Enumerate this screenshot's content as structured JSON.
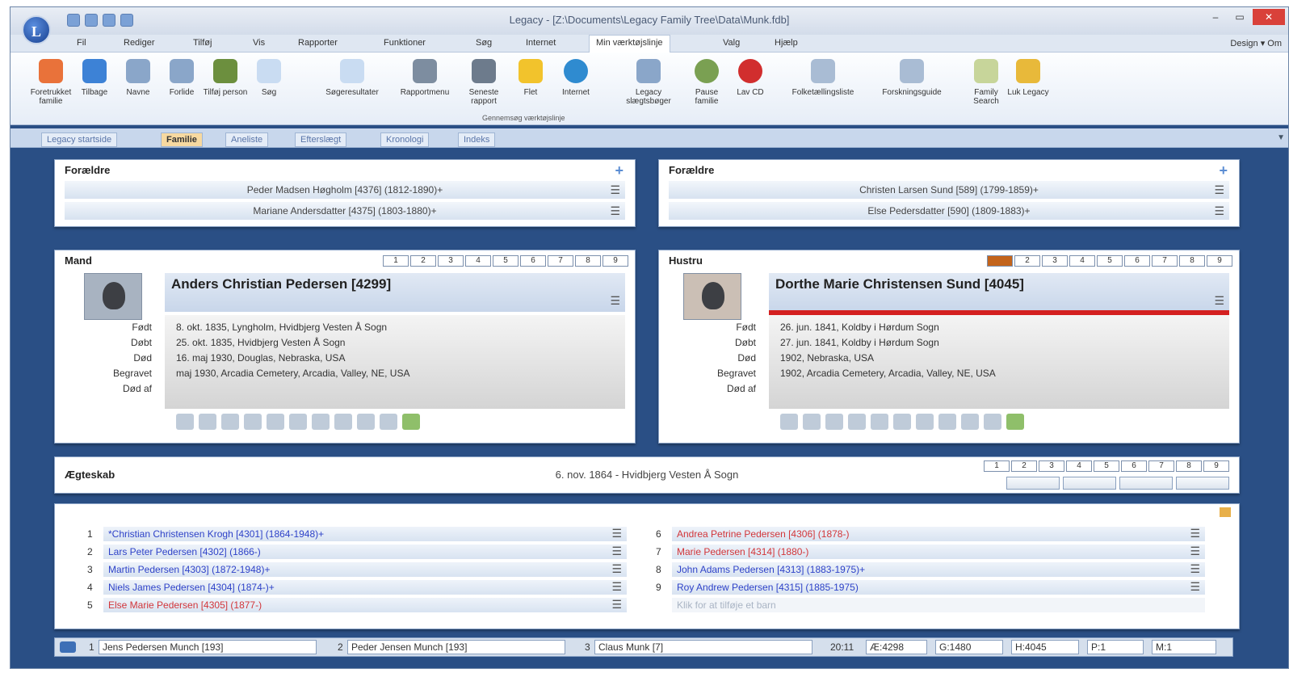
{
  "window": {
    "title": "Legacy - [Z:\\Documents\\Legacy Family Tree\\Data\\Munk.fdb]",
    "app_badge": "L",
    "controls": [
      "–",
      "▭",
      "✕"
    ]
  },
  "menubar": {
    "items": [
      "Fil",
      "Rediger",
      "Tilføj",
      "Vis",
      "Rapporter",
      "Funktioner",
      "Søg",
      "Internet",
      "Min værktøjslinje",
      "Valg",
      "Hjælp"
    ],
    "right": "Design  ▾ Om"
  },
  "ribbon": {
    "buttons": [
      "Foretrukket familie",
      "Tilbage",
      "Navne",
      "Forlide",
      "Tilføj person",
      "Søg",
      "Søgeresultater",
      "Rapportmenu",
      "Seneste rapport",
      "Flet",
      "Internet",
      "Legacy slægtsbøger",
      "Pause familie",
      "Lav CD",
      "Folketællingsliste",
      "Forskningsguide",
      "Family Search",
      "Luk Legacy"
    ],
    "group_label": "Gennemsøg værktøjslinje"
  },
  "view_tabs": [
    "Legacy startside",
    "Familie",
    "Aneliste",
    "Efterslægt",
    "Kronologi",
    "Indeks"
  ],
  "active_tab": "Familie",
  "left_parents": {
    "title": "Forældre",
    "father": "Peder Madsen Høgholm [4376] (1812-1890)+",
    "mother": "Mariane Andersdatter [4375] (1803-1880)+"
  },
  "right_parents": {
    "title": "Forældre",
    "father": "Christen Larsen Sund [589] (1799-1859)+",
    "mother": "Else Pedersdatter [590] (1809-1883)+"
  },
  "husband": {
    "title": "Mand",
    "name": "Anders Christian Pedersen [4299]",
    "spouse_numbers": [
      "1",
      "2",
      "3",
      "4",
      "5",
      "6",
      "7",
      "8",
      "9"
    ],
    "labels": [
      "Født",
      "Døbt",
      "Død",
      "Begravet",
      "Død af"
    ],
    "values": [
      "8. okt. 1835, Lyngholm, Hvidbjerg Vesten Å Sogn",
      "25. okt. 1835, Hvidbjerg Vesten Å Sogn",
      "16. maj 1930, Douglas, Nebraska, USA",
      "maj 1930, Arcadia Cemetery, Arcadia, Valley, NE, USA",
      ""
    ]
  },
  "wife": {
    "title": "Hustru",
    "name": "Dorthe Marie Christensen Sund [4045]",
    "spouse_numbers": [
      "1",
      "2",
      "3",
      "4",
      "5",
      "6",
      "7",
      "8",
      "9"
    ],
    "labels": [
      "Født",
      "Døbt",
      "Død",
      "Begravet",
      "Død af"
    ],
    "values": [
      "26. jun. 1841, Koldby i Hørdum Sogn",
      "27. jun. 1841, Koldby i Hørdum Sogn",
      "1902, Nebraska, USA",
      "1902, Arcadia Cemetery, Arcadia, Valley, NE, USA",
      ""
    ]
  },
  "marriage": {
    "title": "Ægteskab",
    "event": "6. nov. 1864 - Hvidbjerg Vesten Å Sogn",
    "numbers": [
      "1",
      "2",
      "3",
      "4",
      "5",
      "6",
      "7",
      "8",
      "9"
    ]
  },
  "children_left": [
    {
      "num": "1",
      "text": "*Christian Christensen Krogh [4301] (1864-1948)+",
      "color": "blue"
    },
    {
      "num": "2",
      "text": "Lars Peter Pedersen [4302] (1866-)",
      "color": "blue"
    },
    {
      "num": "3",
      "text": "Martin Pedersen [4303] (1872-1948)+",
      "color": "blue"
    },
    {
      "num": "4",
      "text": "Niels James Pedersen [4304] (1874-)+",
      "color": "blue"
    },
    {
      "num": "5",
      "text": "Else Marie Pedersen [4305] (1877-)",
      "color": "red"
    }
  ],
  "children_right": [
    {
      "num": "6",
      "text": "Andrea Petrine Pedersen [4306] (1878-)",
      "color": "red"
    },
    {
      "num": "7",
      "text": "Marie Pedersen [4314] (1880-)",
      "color": "red"
    },
    {
      "num": "8",
      "text": "John Adams Pedersen [4313] (1883-1975)+",
      "color": "blue"
    },
    {
      "num": "9",
      "text": "Roy Andrew Pedersen [4315] (1885-1975)",
      "color": "blue"
    }
  ],
  "add_child_hint": "Klik for at tilføje et barn",
  "statusbar": {
    "b1_num": "1",
    "b1": "Jens Pedersen Munch [193]",
    "b2_num": "2",
    "b2": "Peder Jensen Munch [193]",
    "b3_num": "3",
    "b3": "Claus Munk [7]",
    "time": "20:11",
    "ae": "Æ:4298",
    "g": "G:1480",
    "h": "H:4045",
    "p": "P:1",
    "m": "M:1"
  },
  "colors": {
    "accent_tab": "#f7d9a0",
    "link_blue": "#2e42c8",
    "link_red": "#d2363a",
    "deceased_bar": "#d42020",
    "frame_blue": "#2a4f85"
  }
}
